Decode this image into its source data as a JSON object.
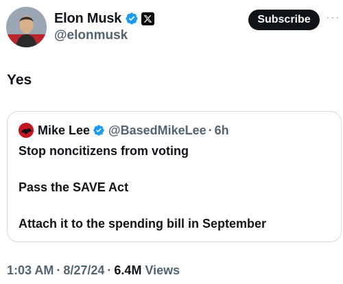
{
  "author": {
    "display_name": "Elon Musk",
    "handle": "@elonmusk",
    "verified_icon": "verified-badge-icon",
    "affiliate_icon": "x-logo-icon"
  },
  "actions": {
    "subscribe_label": "Subscribe",
    "more_label": "···"
  },
  "tweet": {
    "text": "Yes"
  },
  "quote": {
    "display_name": "Mike Lee",
    "handle": "@BasedMikeLee",
    "dot": "·",
    "time": "6h",
    "lines": [
      "Stop noncitizens from voting",
      "Pass the SAVE Act",
      "Attach it to the spending bill in September"
    ]
  },
  "meta": {
    "time": "1:03 AM",
    "sep1": "·",
    "date": "8/27/24",
    "sep2": "·",
    "views_count": "6.4M",
    "views_label": "Views"
  },
  "colors": {
    "verified_blue": "#1d9bf0",
    "muted_text": "#536471",
    "primary_text": "#0f1419",
    "border": "#d4dadf"
  }
}
